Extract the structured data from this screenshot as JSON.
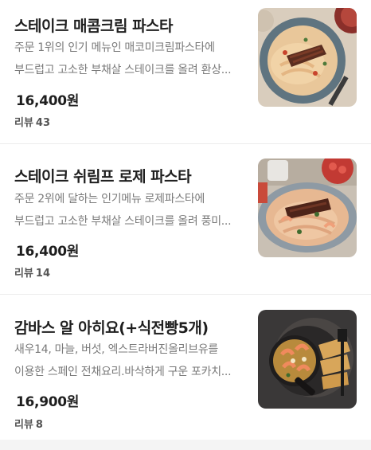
{
  "menu_items": [
    {
      "name": "스테이크 매콤크림 파스타",
      "desc_lines": [
        "주문 1위의 인기 메뉴인 매코미크림파스타에",
        "부드럽고 고소한 부채살 스테이크를 올려 환상..."
      ],
      "price": "16,400원",
      "review_label": "리뷰",
      "review_count": "43",
      "image": "steak-spicy-cream-pasta-photo"
    },
    {
      "name": "스테이크 쉬림프 로제 파스타",
      "desc_lines": [
        "주문 2위에 달하는 인기메뉴 로제파스타에",
        "부드럽고 고소한 부채살 스테이크를 올려 풍미..."
      ],
      "price": "16,400원",
      "review_label": "리뷰",
      "review_count": "14",
      "image": "steak-shrimp-rose-pasta-photo"
    },
    {
      "name": "감바스 알 아히요(+식전빵5개)",
      "desc_lines": [
        "새우14, 마늘, 버섯, 엑스트라버진올리브유를",
        "이용한 스페인 전채요리.바삭하게 구운 포카치..."
      ],
      "price": "16,900원",
      "review_label": "리뷰",
      "review_count": "8",
      "image": "gambas-al-ajillo-photo"
    }
  ]
}
